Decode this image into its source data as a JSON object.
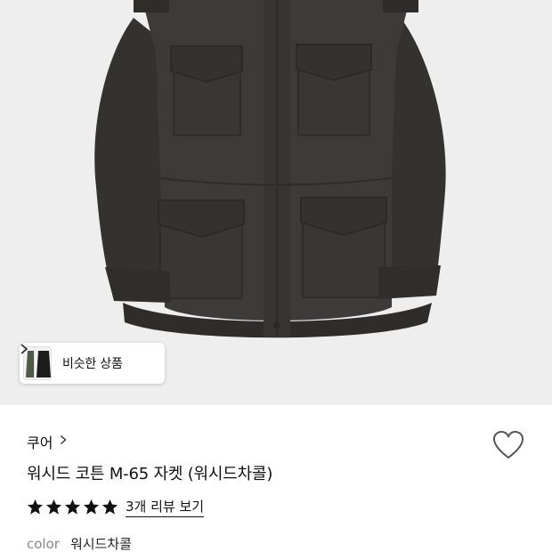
{
  "hero": {
    "image": "charcoal-field-jacket-photo",
    "background": "#eeeeee",
    "jacket_color": "#3b3935"
  },
  "similar_products": {
    "label": "비슷한 상품",
    "chevron": "chevron-right-icon",
    "thumbnails": [
      "green-jacket-thumb",
      "black-jacket-thumb"
    ]
  },
  "product": {
    "brand": "쿠어",
    "brand_chevron": "›",
    "title": "워시드 코튼 M-65 자켓 (워시드차콜)",
    "rating": 5,
    "rating_max": 5,
    "reviews_link": "3개 리뷰 보기",
    "color_label": "color",
    "color_value": "워시드차콜",
    "wishlist_icon": "heart-outline-icon"
  }
}
